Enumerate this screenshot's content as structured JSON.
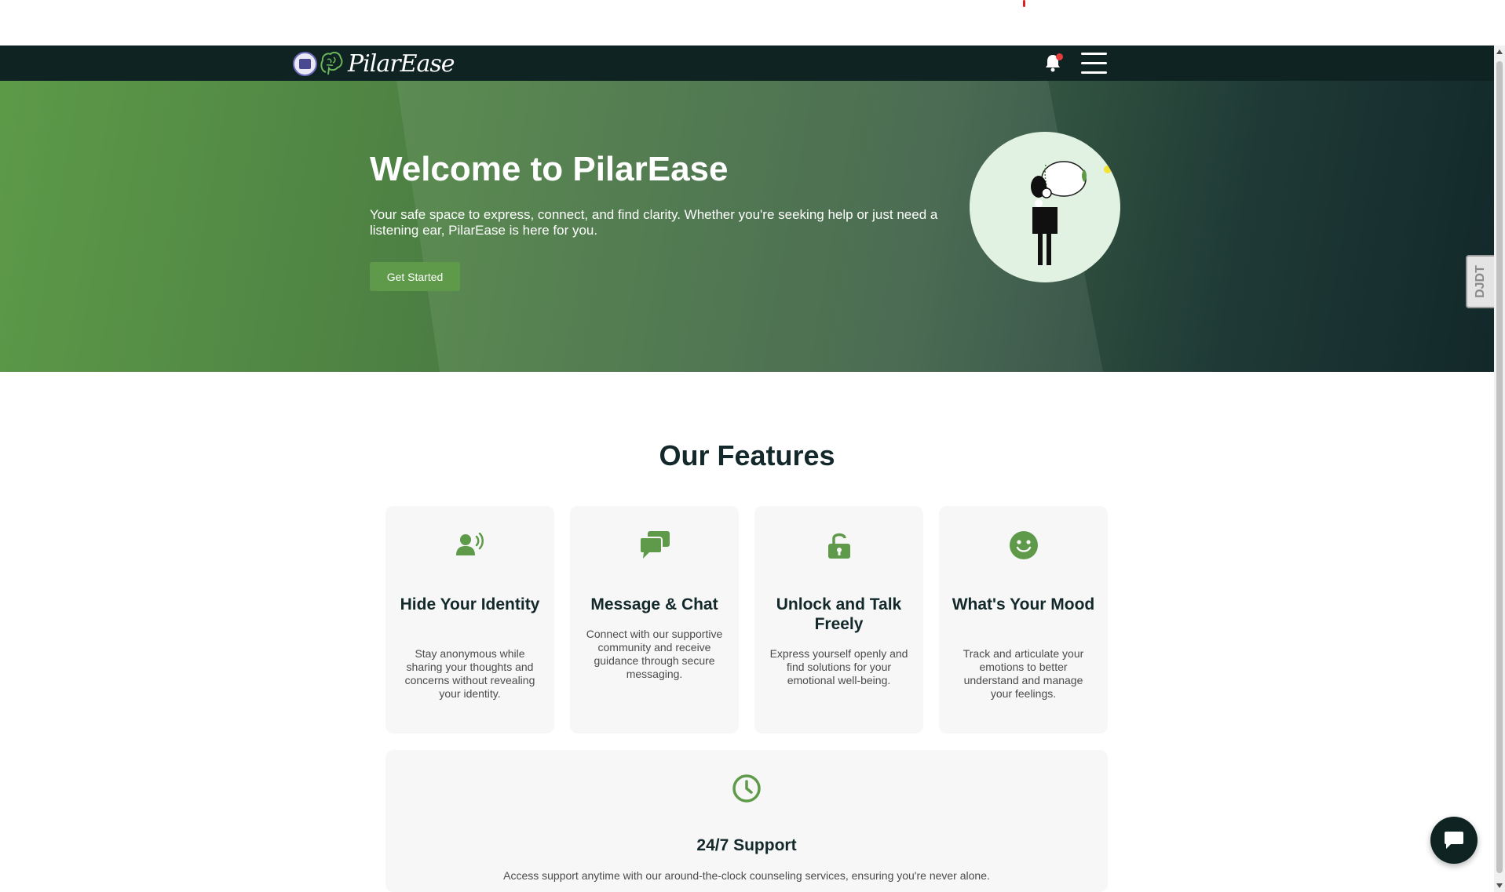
{
  "navbar": {
    "logo_text": "PilarEase",
    "icons": [
      "bell-icon",
      "hamburger-menu-icon"
    ]
  },
  "hero": {
    "title": "Welcome to PilarEase",
    "subtitle": "Your safe space to express, connect, and find clarity. Whether you're seeking help or just need a listening ear, PilarEase is here for you.",
    "cta_label": "Get Started"
  },
  "features": {
    "heading": "Our Features",
    "items": [
      {
        "icon": "speaking-person-icon",
        "title": "Hide Your Identity",
        "description": "Stay anonymous while sharing your thoughts and concerns without revealing your identity."
      },
      {
        "icon": "chat-bubbles-icon",
        "title": "Message & Chat",
        "description": "Connect with our supportive community and receive guidance through secure messaging."
      },
      {
        "icon": "unlock-icon",
        "title": "Unlock and Talk Freely",
        "description": "Express yourself openly and find solutions for your emotional well-being."
      },
      {
        "icon": "smile-icon",
        "title": "What's Your Mood",
        "description": "Track and articulate your emotions to better understand and manage your feelings."
      }
    ],
    "support": {
      "icon": "clock-icon",
      "title": "24/7 Support",
      "description": "Access support anytime with our around-the-clock counseling services, ensuring you're never alone."
    }
  },
  "side_tab": {
    "label": "DJDT"
  },
  "chat_widget": {
    "icon": "chat-icon"
  },
  "colors": {
    "nav_bg": "#0f2323",
    "accent_green": "#5e9a49",
    "card_bg": "#f6f7f6",
    "notification_red": "#e63c3c"
  }
}
